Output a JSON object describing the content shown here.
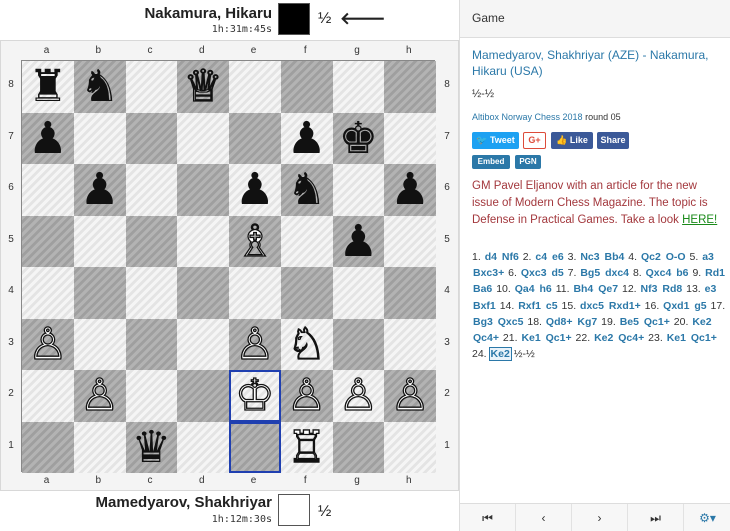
{
  "top_player": {
    "name": "Nakamura, Hikaru",
    "clock": "1h:31m:45s",
    "color": "black",
    "result": "½",
    "turn_arrow": "🡐"
  },
  "bottom_player": {
    "name": "Mamedyarov, Shakhriyar",
    "clock": "1h:12m:30s",
    "color": "white",
    "result": "½"
  },
  "board": {
    "files": [
      "a",
      "b",
      "c",
      "d",
      "e",
      "f",
      "g",
      "h"
    ],
    "ranks": [
      "8",
      "7",
      "6",
      "5",
      "4",
      "3",
      "2",
      "1"
    ],
    "pieces": [
      {
        "square": "a8",
        "piece": "♜",
        "color": "b",
        "name": "black-rook"
      },
      {
        "square": "b8",
        "piece": "♞",
        "color": "b",
        "name": "black-knight"
      },
      {
        "square": "d8",
        "piece": "♕",
        "color": "w",
        "name": "white-queen"
      },
      {
        "square": "a7",
        "piece": "♟",
        "color": "b",
        "name": "black-pawn"
      },
      {
        "square": "f7",
        "piece": "♟",
        "color": "b",
        "name": "black-pawn"
      },
      {
        "square": "g7",
        "piece": "♚",
        "color": "b",
        "name": "black-king"
      },
      {
        "square": "b6",
        "piece": "♟",
        "color": "b",
        "name": "black-pawn"
      },
      {
        "square": "e6",
        "piece": "♟",
        "color": "b",
        "name": "black-pawn"
      },
      {
        "square": "f6",
        "piece": "♞",
        "color": "b",
        "name": "black-knight"
      },
      {
        "square": "h6",
        "piece": "♟",
        "color": "b",
        "name": "black-pawn"
      },
      {
        "square": "e5",
        "piece": "♗",
        "color": "w",
        "name": "white-bishop"
      },
      {
        "square": "g5",
        "piece": "♟",
        "color": "b",
        "name": "black-pawn"
      },
      {
        "square": "a3",
        "piece": "♙",
        "color": "w",
        "name": "white-pawn"
      },
      {
        "square": "e3",
        "piece": "♙",
        "color": "w",
        "name": "white-pawn"
      },
      {
        "square": "f3",
        "piece": "♘",
        "color": "w",
        "name": "white-knight"
      },
      {
        "square": "b2",
        "piece": "♙",
        "color": "w",
        "name": "white-pawn"
      },
      {
        "square": "e2",
        "piece": "♔",
        "color": "w",
        "name": "white-king"
      },
      {
        "square": "f2",
        "piece": "♙",
        "color": "w",
        "name": "white-pawn"
      },
      {
        "square": "g2",
        "piece": "♙",
        "color": "w",
        "name": "white-pawn"
      },
      {
        "square": "h2",
        "piece": "♙",
        "color": "w",
        "name": "white-pawn"
      },
      {
        "square": "c1",
        "piece": "♛",
        "color": "b",
        "name": "black-queen"
      },
      {
        "square": "f1",
        "piece": "♖",
        "color": "w",
        "name": "white-rook"
      }
    ],
    "highlighted_squares": [
      "e2",
      "e1"
    ],
    "highlight_color": "#1f3fb0"
  },
  "panel": {
    "title": "Game",
    "game_title": "Mamedyarov, Shakhriyar (AZE) - Nakamura, Hikaru (USA)",
    "result": "½-½",
    "event": "Altibox Norway Chess 2018",
    "round": "round 05",
    "tweet": "Tweet",
    "gplus": "G+",
    "like": "Like",
    "share": "Share",
    "embed": "Embed",
    "pgn": "PGN",
    "promo_text": "GM Pavel Eljanov with an article for the new issue of Modern Chess Magazine. The topic is Defense in Practical Games. Take a look",
    "promo_link": "HERE!",
    "promo_end": ""
  },
  "moves": [
    {
      "n": "1.",
      "w": "d4",
      "b": "Nf6"
    },
    {
      "n": "2.",
      "w": "c4",
      "b": "e6"
    },
    {
      "n": "3.",
      "w": "Nc3",
      "b": "Bb4"
    },
    {
      "n": "4.",
      "w": "Qc2",
      "b": "O-O"
    },
    {
      "n": "5.",
      "w": "a3",
      "b": "Bxc3+"
    },
    {
      "n": "6.",
      "w": "Qxc3",
      "b": "d5"
    },
    {
      "n": "7.",
      "w": "Bg5",
      "b": "dxc4"
    },
    {
      "n": "8.",
      "w": "Qxc4",
      "b": "b6"
    },
    {
      "n": "9.",
      "w": "Rd1",
      "b": "Ba6"
    },
    {
      "n": "10.",
      "w": "Qa4",
      "b": "h6"
    },
    {
      "n": "11.",
      "w": "Bh4",
      "b": "Qe7"
    },
    {
      "n": "12.",
      "w": "Nf3",
      "b": "Rd8"
    },
    {
      "n": "13.",
      "w": "e3",
      "b": "Bxf1"
    },
    {
      "n": "14.",
      "w": "Rxf1",
      "b": "c5"
    },
    {
      "n": "15.",
      "w": "dxc5",
      "b": "Rxd1+"
    },
    {
      "n": "16.",
      "w": "Qxd1",
      "b": "g5"
    },
    {
      "n": "17.",
      "w": "Bg3",
      "b": "Qxc5"
    },
    {
      "n": "18.",
      "w": "Qd8+",
      "b": "Kg7"
    },
    {
      "n": "19.",
      "w": "Be5",
      "b": "Qc1+"
    },
    {
      "n": "20.",
      "w": "Ke2",
      "b": "Qc4+"
    },
    {
      "n": "21.",
      "w": "Ke1",
      "b": "Qc1+"
    },
    {
      "n": "22.",
      "w": "Ke2",
      "b": "Qc4+"
    },
    {
      "n": "23.",
      "w": "Ke1",
      "b": "Qc1+"
    },
    {
      "n": "24.",
      "w": "Ke2",
      "b": null
    }
  ],
  "final_result": "½-½",
  "current_move": "24.w",
  "nav": {
    "first": "⏮",
    "prev": "‹",
    "next": "›",
    "last": "⏭",
    "settings": "⚙▾"
  }
}
